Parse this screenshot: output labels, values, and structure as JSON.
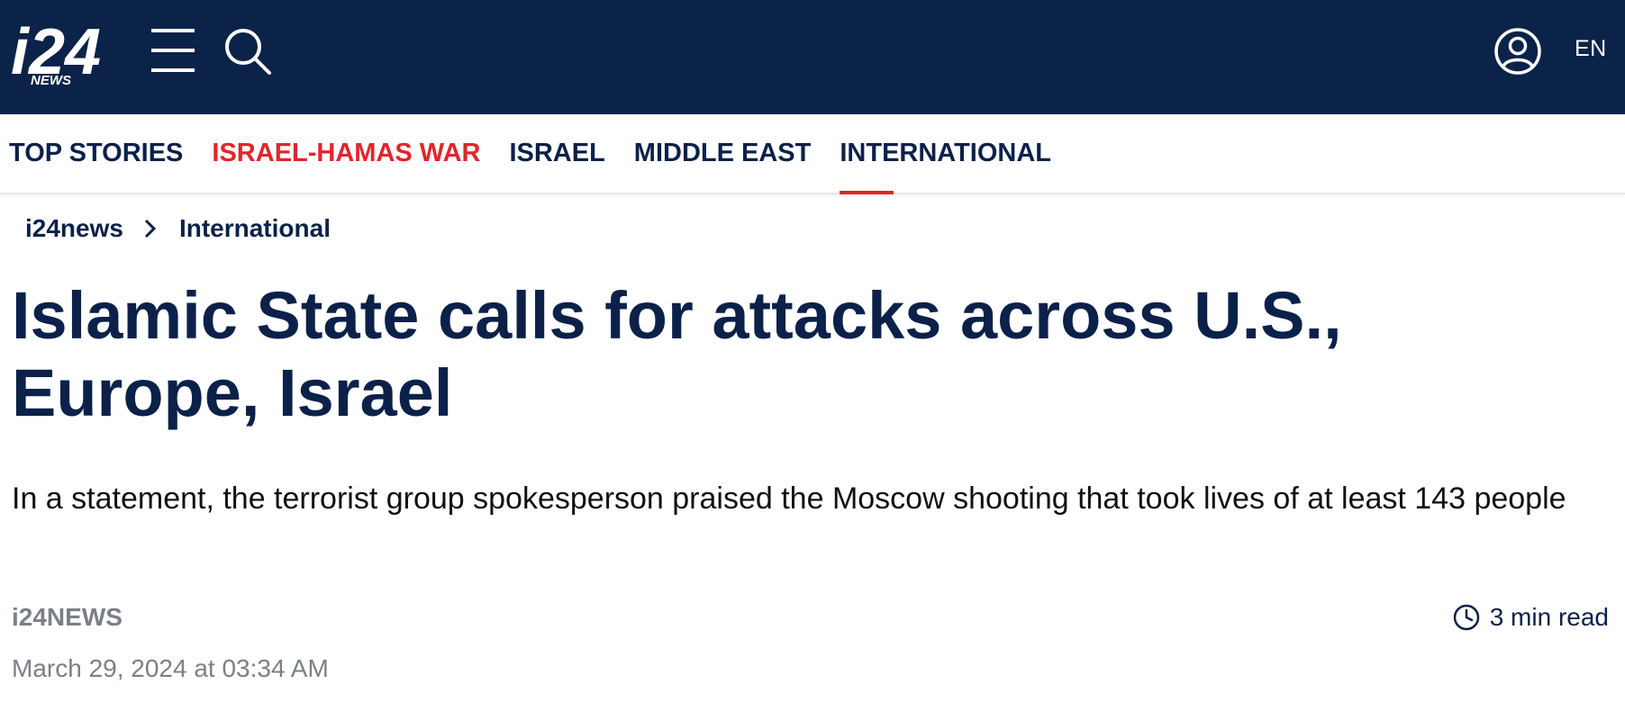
{
  "header": {
    "logo_text": "i24",
    "logo_subtext": "NEWS",
    "language": "EN",
    "icons": {
      "menu": "hamburger-menu-icon",
      "search": "search-icon",
      "account": "user-account-icon"
    },
    "colors": {
      "bar_bg": "#0b2349",
      "foreground": "#ffffff"
    }
  },
  "nav": {
    "items": [
      {
        "label": "TOP STORIES"
      },
      {
        "label": "ISRAEL-HAMAS WAR",
        "color": "#e0252b"
      },
      {
        "label": "ISRAEL"
      },
      {
        "label": "MIDDLE EAST"
      },
      {
        "label": "INTERNATIONAL",
        "active": true
      }
    ],
    "accent_color": "#e0252b"
  },
  "breadcrumb": {
    "home": "i24news",
    "current": "International"
  },
  "article": {
    "headline": "Islamic State calls for attacks across U.S., Europe, Israel",
    "subheadline": "In a statement, the terrorist group spokesperson praised the Moscow shooting that took lives of at least 143 people",
    "author": "i24NEWS",
    "read_time": "3 min read",
    "date": "March 29, 2024 at 03:34 AM"
  }
}
